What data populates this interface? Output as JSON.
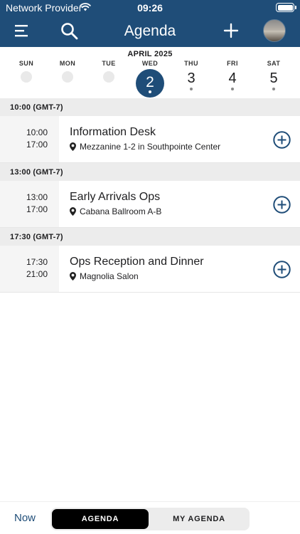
{
  "status": {
    "carrier": "Network Provider",
    "time": "09:26"
  },
  "header": {
    "title": "Agenda"
  },
  "calendar": {
    "month": "APRIL 2025",
    "days": [
      {
        "name": "SUN",
        "num": ""
      },
      {
        "name": "MON",
        "num": ""
      },
      {
        "name": "TUE",
        "num": ""
      },
      {
        "name": "WED",
        "num": "2"
      },
      {
        "name": "THU",
        "num": "3"
      },
      {
        "name": "FRI",
        "num": "4"
      },
      {
        "name": "SAT",
        "num": "5"
      }
    ]
  },
  "groups": [
    {
      "header": "10:00 (GMT-7)",
      "start": "10:00",
      "end": "17:00",
      "title": "Information Desk",
      "location": "Mezzanine 1-2 in Southpointe Center"
    },
    {
      "header": "13:00 (GMT-7)",
      "start": "13:00",
      "end": "17:00",
      "title": "Early Arrivals Ops",
      "location": "Cabana Ballroom A-B"
    },
    {
      "header": "17:30 (GMT-7)",
      "start": "17:30",
      "end": "21:00",
      "title": "Ops Reception and Dinner",
      "location": "Magnolia Salon"
    }
  ],
  "bottom": {
    "now": "Now",
    "tab_agenda": "AGENDA",
    "tab_my_agenda": "MY AGENDA"
  },
  "colors": {
    "brand": "#1f4d78",
    "group_bg": "#ececec",
    "time_bg": "#f5f5f5"
  }
}
